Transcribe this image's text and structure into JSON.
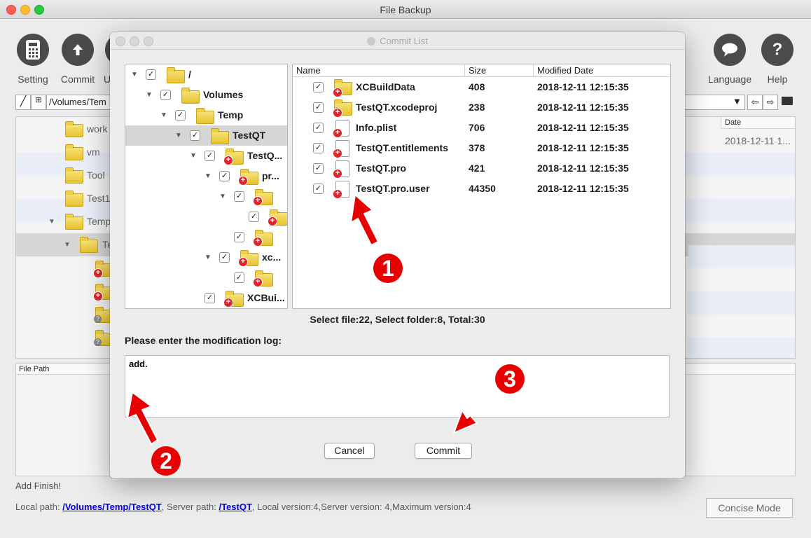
{
  "window": {
    "title": "File Backup"
  },
  "toolbar": {
    "setting": "Setting",
    "commit": "Commit",
    "update_partial": "U",
    "language": "Language",
    "help": "Help"
  },
  "pathbar": {
    "path": "/Volumes/Tem"
  },
  "bg_list": {
    "date_header": "Date",
    "date_value": "2018-12-11 1...",
    "items": [
      "work",
      "vm",
      "Tool",
      "Test1",
      "Temp",
      "Te"
    ]
  },
  "file_path_header": "File Path",
  "status": {
    "message": "Add Finish!",
    "local_label": "Local path: ",
    "local_path": "/Volumes/Temp/TestQT",
    "server_label": ", Server path: ",
    "server_path": "/TestQT",
    "versions": ", Local version:4,Server version: 4,Maximum version:4"
  },
  "concise_mode": "Concise Mode",
  "dialog": {
    "title": "Commit List",
    "tree": [
      {
        "label": "/"
      },
      {
        "label": "Volumes"
      },
      {
        "label": "Temp"
      },
      {
        "label": "TestQT"
      },
      {
        "label": "TestQ..."
      },
      {
        "label": "pr..."
      },
      {
        "label": ""
      },
      {
        "label": ""
      },
      {
        "label": ""
      },
      {
        "label": "xc..."
      },
      {
        "label": ""
      },
      {
        "label": "XCBui..."
      }
    ],
    "columns": {
      "name": "Name",
      "size": "Size",
      "date": "Modified Date"
    },
    "files": [
      {
        "name": "XCBuildData",
        "size": "408",
        "date": "2018-12-11 12:15:35",
        "icon": "folder-add-icon"
      },
      {
        "name": "TestQT.xcodeproj",
        "size": "238",
        "date": "2018-12-11 12:15:35",
        "icon": "folder-add-icon"
      },
      {
        "name": "Info.plist",
        "size": "706",
        "date": "2018-12-11 12:15:35",
        "icon": "plist-file-add-icon"
      },
      {
        "name": "TestQT.entitlements",
        "size": "378",
        "date": "2018-12-11 12:15:35",
        "icon": "certificate-file-add-icon"
      },
      {
        "name": "TestQT.pro",
        "size": "421",
        "date": "2018-12-11 12:15:35",
        "icon": "pro-file-add-icon"
      },
      {
        "name": "TestQT.pro.user",
        "size": "44350",
        "date": "2018-12-11 12:15:35",
        "icon": "file-add-icon"
      }
    ],
    "summary": "Select file:22, Select folder:8, Total:30",
    "log_label": "Please enter the modification log:",
    "log_value": "add.",
    "cancel": "Cancel",
    "commit": "Commit"
  },
  "annotations": {
    "one": "1",
    "two": "2",
    "three": "3",
    "color": "#e60000"
  }
}
